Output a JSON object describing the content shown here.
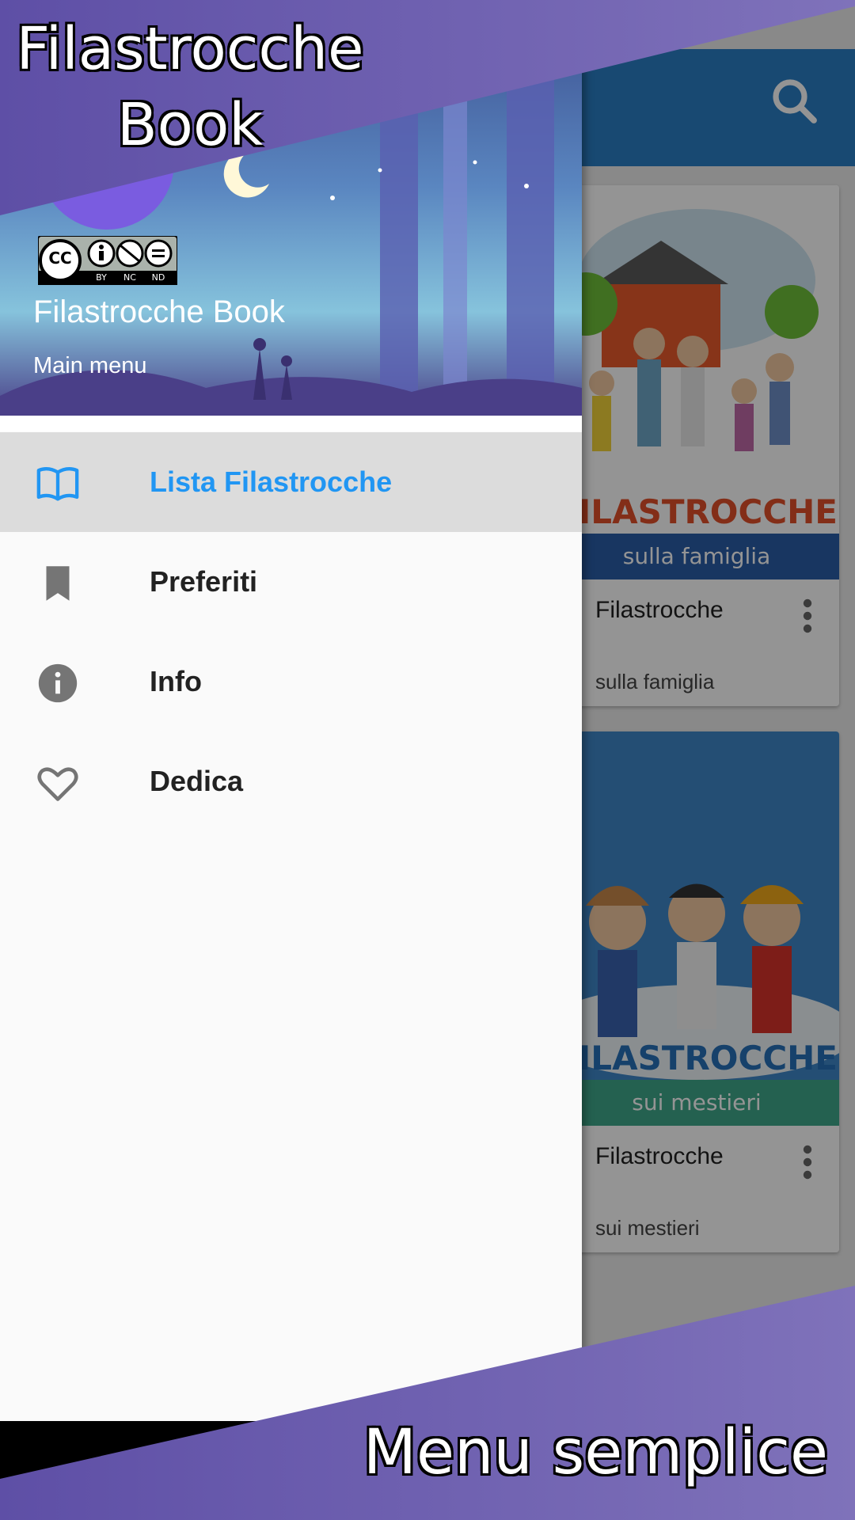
{
  "promo": {
    "top_caption_line1": "Filastrocche",
    "top_caption_line2": "Book",
    "bottom_caption": "Menu semplice"
  },
  "drawer": {
    "license_badge": {
      "label": "CC",
      "sub_labels": [
        "BY",
        "NC",
        "ND"
      ]
    },
    "title": "Filastrocche Book",
    "subtitle": "Main menu",
    "items": [
      {
        "label": "Lista Filastrocche",
        "icon": "open-book-icon",
        "active": true
      },
      {
        "label": "Preferiti",
        "icon": "bookmark-icon",
        "active": false
      },
      {
        "label": "Info",
        "icon": "info-icon",
        "active": false
      },
      {
        "label": "Dedica",
        "icon": "heart-outline-icon",
        "active": false
      }
    ]
  },
  "cards": [
    {
      "thumb_title": "FILASTROCCHE",
      "thumb_band": "sulla famiglia",
      "title": "Filastrocche",
      "subtitle": "sulla famiglia"
    },
    {
      "thumb_title": "FILASTROCCHE",
      "thumb_band": "sui mestieri",
      "title": "Filastrocche",
      "subtitle": "sui mestieri"
    }
  ],
  "colors": {
    "accent": "#2196f3",
    "appbar": "#2a7fc4",
    "promo_purple": "#6a5cae",
    "drawer_bg": "#fafafa",
    "active_item_bg": "#dcdcdc"
  }
}
